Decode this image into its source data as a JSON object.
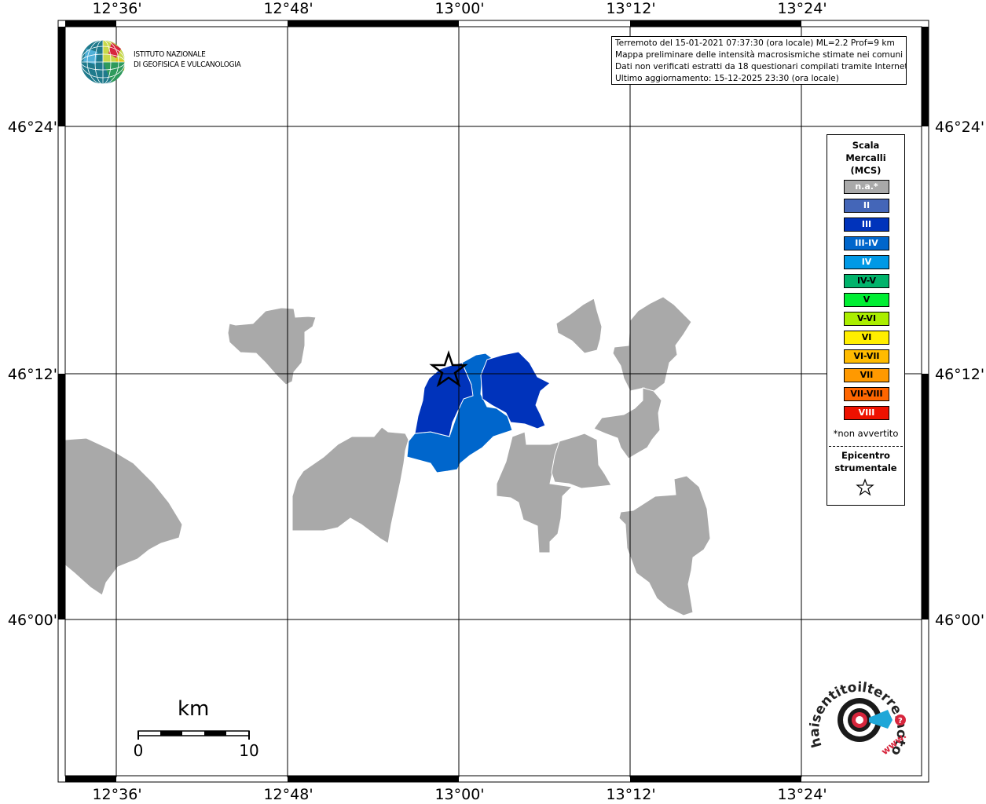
{
  "coordinates": {
    "top_lon": [
      "12°36'",
      "12°48'",
      "13°00'",
      "13°12'",
      "13°24'"
    ],
    "bottom_lon": [
      "12°36'",
      "12°48'",
      "13°00'",
      "13°12'",
      "13°24'"
    ],
    "left_lat": [
      "46°24'",
      "46°12'",
      "46°00'"
    ],
    "right_lat": [
      "46°24'",
      "46°12'",
      "46°00'"
    ]
  },
  "info": {
    "line1": "Terremoto del 15-01-2021 07:37:30 (ora locale) ML=2.2 Prof=9 km",
    "line2": "Mappa preliminare delle intensità macrosismiche stimate nei comuni",
    "line3": "Dati non verificati estratti da 18 questionari compilati tramite Internet.",
    "line4": "Ultimo aggiornamento: 15-12-2025 23:30 (ora locale)"
  },
  "logo": {
    "line1": "ISTITUTO NAZIONALE",
    "line2": "DI GEOFISICA E VULCANOLOGIA"
  },
  "legend": {
    "title1": "Scala",
    "title2": "Mercalli",
    "title3": "(MCS)",
    "items": [
      {
        "label": "n.a.*",
        "color": "#a9a9a9",
        "text": "#ffffff"
      },
      {
        "label": "II",
        "color": "#4466b8",
        "text": "#ffffff"
      },
      {
        "label": "III",
        "color": "#0033bb",
        "text": "#ffffff"
      },
      {
        "label": "III-IV",
        "color": "#0066cc",
        "text": "#ffffff"
      },
      {
        "label": "IV",
        "color": "#0099e6",
        "text": "#ffffff"
      },
      {
        "label": "IV-V",
        "color": "#00b36b",
        "text": "#000000"
      },
      {
        "label": "V",
        "color": "#00ee33",
        "text": "#000000"
      },
      {
        "label": "V-VI",
        "color": "#aaee00",
        "text": "#000000"
      },
      {
        "label": "VI",
        "color": "#ffee00",
        "text": "#000000"
      },
      {
        "label": "VI-VII",
        "color": "#ffbb00",
        "text": "#000000"
      },
      {
        "label": "VII",
        "color": "#ff9900",
        "text": "#000000"
      },
      {
        "label": "VII-VIII",
        "color": "#ff6600",
        "text": "#000000"
      },
      {
        "label": "VIII",
        "color": "#ee1100",
        "text": "#ffffff"
      }
    ],
    "note": "*non avvertito",
    "epicentre1": "Epicentro",
    "epicentre2": "strumentale"
  },
  "scalebar": {
    "unit": "km",
    "min": "0",
    "max": "10"
  },
  "watermark": {
    "text": "haisentitoilterremoto.it",
    "url": "www."
  },
  "colors": {
    "gray": "#a9a9a9",
    "III": "#0033bb",
    "III-IV": "#0066cc"
  }
}
